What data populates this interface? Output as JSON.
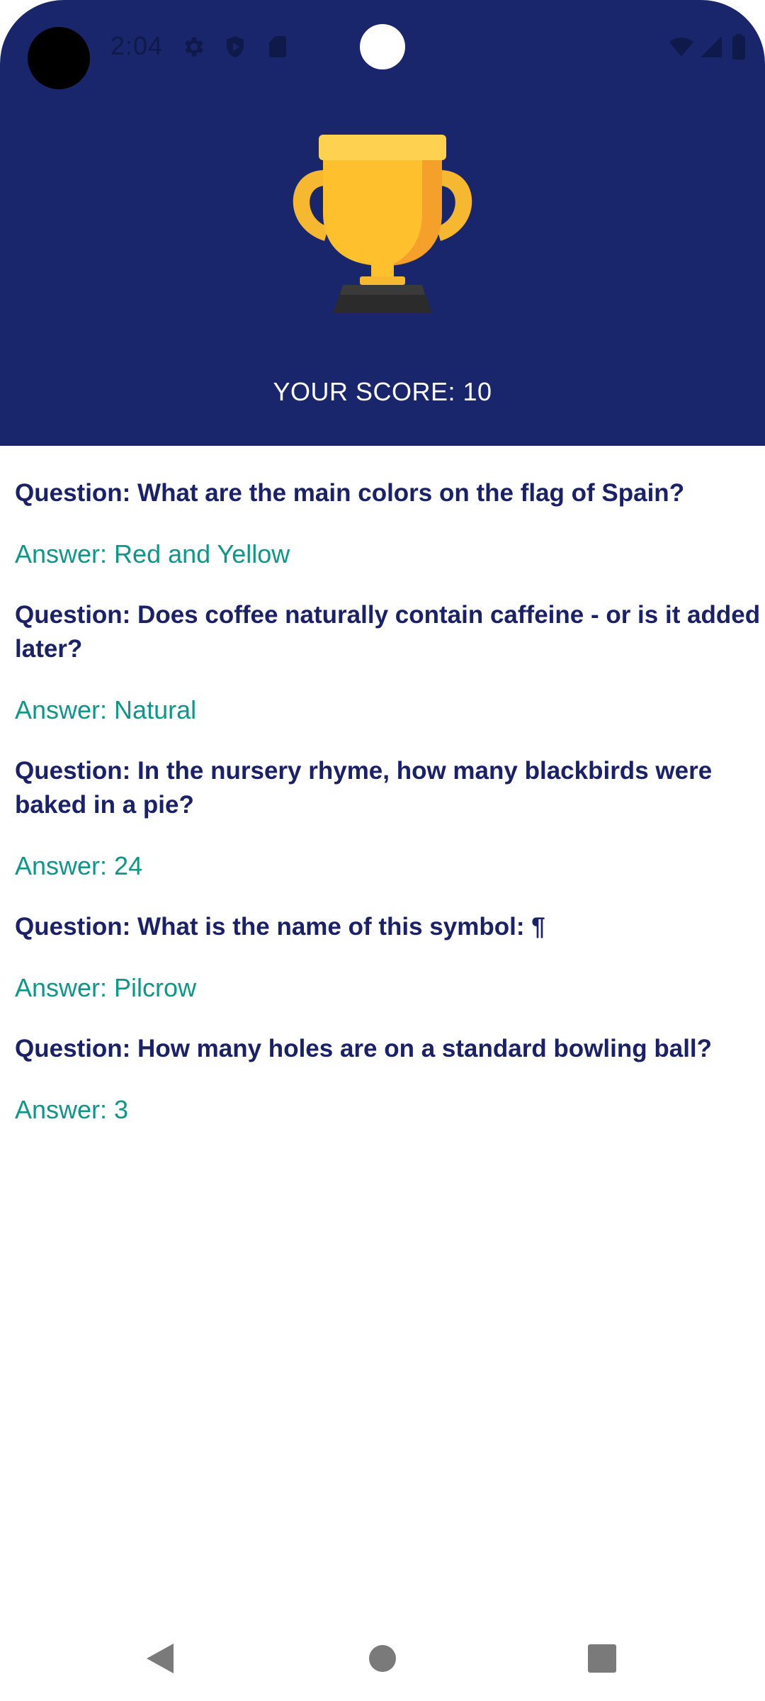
{
  "status_bar": {
    "time": "2:04",
    "icons": [
      "settings-icon",
      "shield-icon",
      "sd-card-icon",
      "wifi-icon",
      "signal-icon",
      "battery-icon"
    ]
  },
  "header": {
    "trophy_icon": "trophy-icon",
    "score_text": "YOUR SCORE: 10",
    "background": "#1a266b"
  },
  "results": [
    {
      "question": "Question: What are the main colors on the flag of Spain?",
      "answer": "Answer: Red and Yellow"
    },
    {
      "question": "Question: Does coffee naturally contain caffeine - or is it added later?",
      "answer": "Answer: Natural"
    },
    {
      "question": "Question: In the nursery rhyme, how many blackbirds were baked in a pie?",
      "answer": "Answer: 24"
    },
    {
      "question": "Question: What is the name of this symbol: ¶",
      "answer": "Answer: Pilcrow"
    },
    {
      "question": "Question: How many holes are on a standard bowling ball?",
      "answer": "Answer: 3"
    }
  ],
  "colors": {
    "question": "#1a2167",
    "answer": "#0f9688"
  },
  "nav_bar": {
    "icons": [
      "back-icon",
      "home-icon",
      "recents-icon"
    ]
  }
}
